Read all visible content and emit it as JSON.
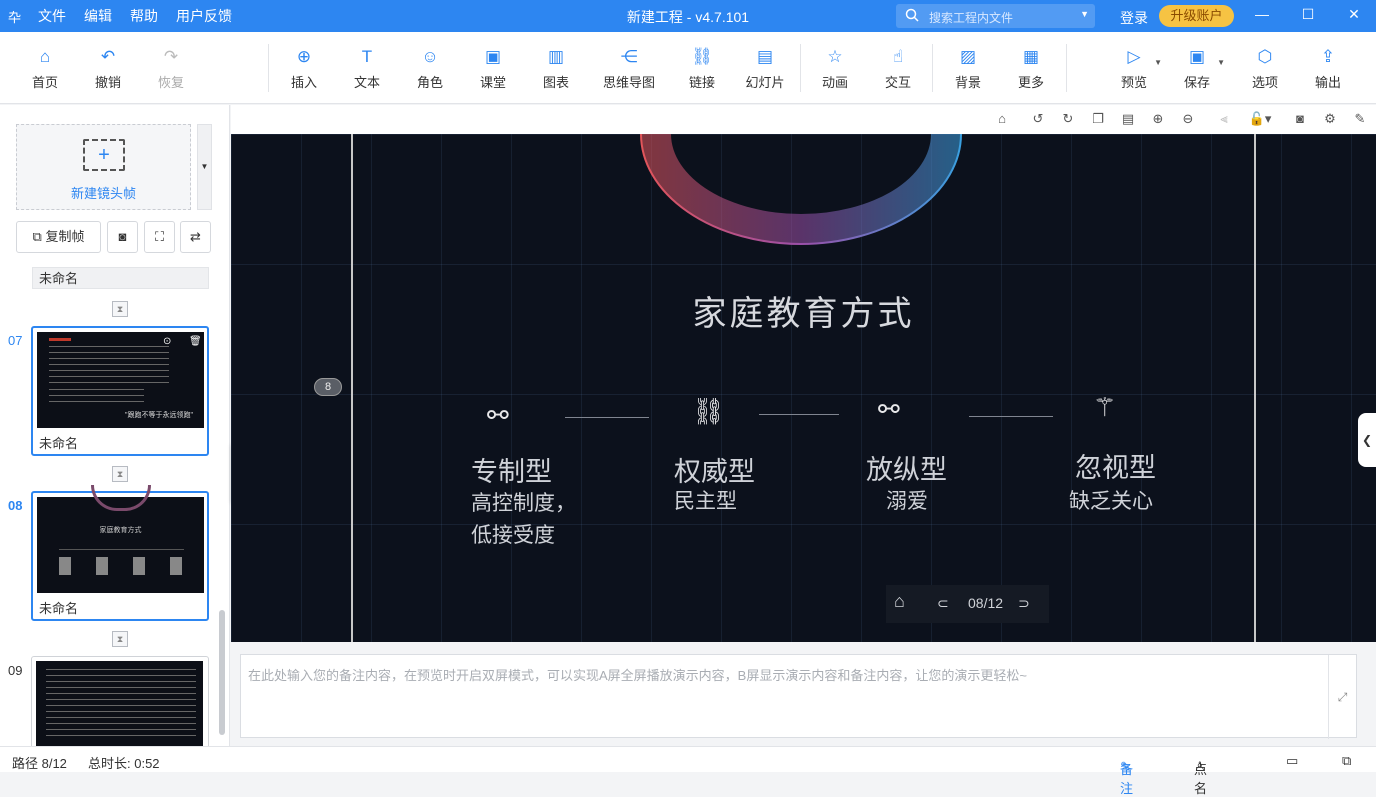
{
  "titlebar": {
    "logo": "卆",
    "menu": [
      "文件",
      "编辑",
      "帮助",
      "用户反馈"
    ],
    "title": "新建工程 - v4.7.101",
    "search_placeholder": "搜索工程内文件",
    "login": "登录",
    "upgrade": "升级账户",
    "win_min": "—",
    "win_max": "☐",
    "win_close": "✕"
  },
  "toolbar": {
    "items": [
      {
        "label": "首页",
        "icon": "⌂"
      },
      {
        "label": "撤销",
        "icon": "↶"
      },
      {
        "label": "恢复",
        "icon": "↷"
      },
      {
        "label": "插入",
        "icon": "⊕"
      },
      {
        "label": "文本",
        "icon": "T"
      },
      {
        "label": "角色",
        "icon": "☺"
      },
      {
        "label": "课堂",
        "icon": "▣"
      },
      {
        "label": "图表",
        "icon": "▥"
      },
      {
        "label": "思维导图",
        "icon": "⋲"
      },
      {
        "label": "链接",
        "icon": "⛓"
      },
      {
        "label": "幻灯片",
        "icon": "▤"
      },
      {
        "label": "动画",
        "icon": "☆"
      },
      {
        "label": "交互",
        "icon": "☝"
      },
      {
        "label": "背景",
        "icon": "▨"
      },
      {
        "label": "更多",
        "icon": "▦"
      },
      {
        "label": "预览",
        "icon": "▷"
      },
      {
        "label": "保存",
        "icon": "▣"
      },
      {
        "label": "选项",
        "icon": "⬡"
      },
      {
        "label": "输出",
        "icon": "⇪"
      }
    ]
  },
  "left": {
    "new_frame": "新建镜头帧",
    "copy_frame": "复制帧",
    "frames": [
      {
        "num": "",
        "name": "未命名"
      },
      {
        "num": "07",
        "name": "未命名",
        "thumb_quote": "\"跟跑不等于永远领跑\""
      },
      {
        "num": "08",
        "name": "未命名",
        "thumb_title": "家庭教育方式"
      },
      {
        "num": "09",
        "name": ""
      }
    ]
  },
  "stage": {
    "title": "家庭教育方式",
    "badge": "8",
    "categories": [
      {
        "title": "专制型",
        "sub": [
          "高控制度，",
          "低接受度"
        ]
      },
      {
        "title": "权威型",
        "sub": [
          "民主型"
        ]
      },
      {
        "title": "放纵型",
        "sub": [
          "溺爱"
        ]
      },
      {
        "title": "忽视型",
        "sub": [
          "缺乏关心"
        ]
      }
    ],
    "pager": "08/12"
  },
  "notes": {
    "placeholder": "在此处输入您的备注内容，在预览时开启双屏模式，可以实现A屏全屏播放演示内容，B屏显示演示内容和备注内容，让您的演示更轻松~"
  },
  "status": {
    "path": "路径 8/12",
    "duration": "总时长: 0:52",
    "notes": "备注",
    "rollcall": "点名"
  }
}
